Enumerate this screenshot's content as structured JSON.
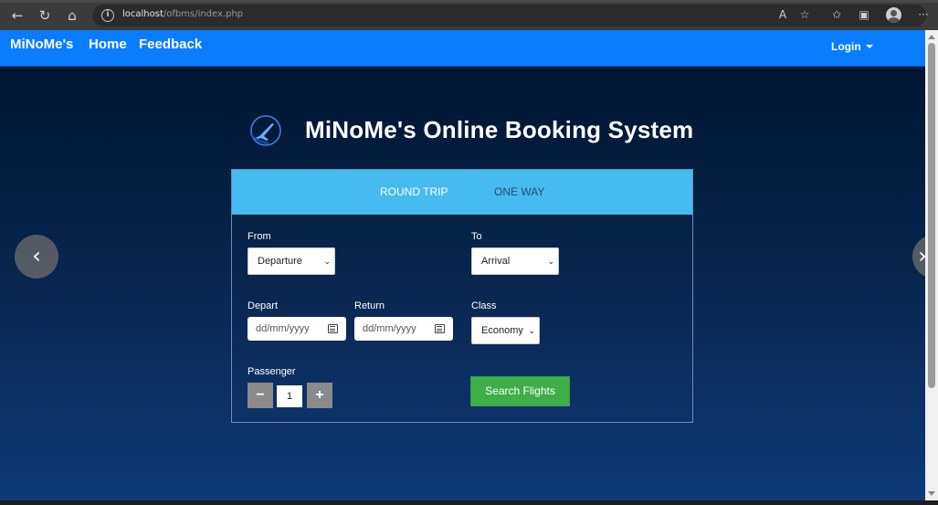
{
  "browser": {
    "url_host": "localhost",
    "url_path": "/ofbms/index.php",
    "icons": [
      "back-icon",
      "refresh-icon",
      "home-icon",
      "info-icon",
      "read-aloud-icon",
      "favorite-add-icon",
      "favorites-icon",
      "collections-icon",
      "profile-icon",
      "more-icon"
    ]
  },
  "navbar": {
    "brand": "MiNoMe's",
    "links": [
      "Home",
      "Feedback"
    ],
    "login": "Login"
  },
  "hero": {
    "title": "MiNoMe's Online Booking System"
  },
  "booking": {
    "tabs": [
      "ROUND TRIP",
      "ONE WAY"
    ],
    "active_tab": "ROUND TRIP",
    "from_label": "From",
    "from_value": "Departure",
    "to_label": "To",
    "to_value": "Arrival",
    "depart_label": "Depart",
    "depart_placeholder": "dd/mm/yyyy",
    "return_label": "Return",
    "return_placeholder": "dd/mm/yyyy",
    "class_label": "Class",
    "class_value": "Economy",
    "passenger_label": "Passenger",
    "minus": "−",
    "plus": "+",
    "passenger_count": "1",
    "search_button": "Search Flights"
  },
  "colors": {
    "navbar": "#0a7cff",
    "card_header": "#45bbf0",
    "search_button": "#3fae49"
  }
}
